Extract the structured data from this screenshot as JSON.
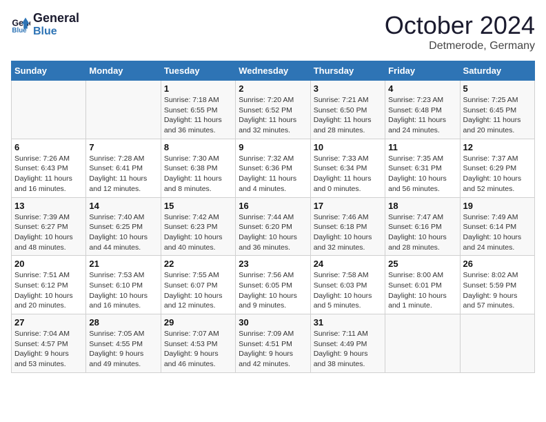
{
  "header": {
    "logo_line1": "General",
    "logo_line2": "Blue",
    "month_title": "October 2024",
    "location": "Detmerode, Germany"
  },
  "weekdays": [
    "Sunday",
    "Monday",
    "Tuesday",
    "Wednesday",
    "Thursday",
    "Friday",
    "Saturday"
  ],
  "weeks": [
    [
      {
        "day": "",
        "info": ""
      },
      {
        "day": "",
        "info": ""
      },
      {
        "day": "1",
        "info": "Sunrise: 7:18 AM\nSunset: 6:55 PM\nDaylight: 11 hours\nand 36 minutes."
      },
      {
        "day": "2",
        "info": "Sunrise: 7:20 AM\nSunset: 6:52 PM\nDaylight: 11 hours\nand 32 minutes."
      },
      {
        "day": "3",
        "info": "Sunrise: 7:21 AM\nSunset: 6:50 PM\nDaylight: 11 hours\nand 28 minutes."
      },
      {
        "day": "4",
        "info": "Sunrise: 7:23 AM\nSunset: 6:48 PM\nDaylight: 11 hours\nand 24 minutes."
      },
      {
        "day": "5",
        "info": "Sunrise: 7:25 AM\nSunset: 6:45 PM\nDaylight: 11 hours\nand 20 minutes."
      }
    ],
    [
      {
        "day": "6",
        "info": "Sunrise: 7:26 AM\nSunset: 6:43 PM\nDaylight: 11 hours\nand 16 minutes."
      },
      {
        "day": "7",
        "info": "Sunrise: 7:28 AM\nSunset: 6:41 PM\nDaylight: 11 hours\nand 12 minutes."
      },
      {
        "day": "8",
        "info": "Sunrise: 7:30 AM\nSunset: 6:38 PM\nDaylight: 11 hours\nand 8 minutes."
      },
      {
        "day": "9",
        "info": "Sunrise: 7:32 AM\nSunset: 6:36 PM\nDaylight: 11 hours\nand 4 minutes."
      },
      {
        "day": "10",
        "info": "Sunrise: 7:33 AM\nSunset: 6:34 PM\nDaylight: 11 hours\nand 0 minutes."
      },
      {
        "day": "11",
        "info": "Sunrise: 7:35 AM\nSunset: 6:31 PM\nDaylight: 10 hours\nand 56 minutes."
      },
      {
        "day": "12",
        "info": "Sunrise: 7:37 AM\nSunset: 6:29 PM\nDaylight: 10 hours\nand 52 minutes."
      }
    ],
    [
      {
        "day": "13",
        "info": "Sunrise: 7:39 AM\nSunset: 6:27 PM\nDaylight: 10 hours\nand 48 minutes."
      },
      {
        "day": "14",
        "info": "Sunrise: 7:40 AM\nSunset: 6:25 PM\nDaylight: 10 hours\nand 44 minutes."
      },
      {
        "day": "15",
        "info": "Sunrise: 7:42 AM\nSunset: 6:23 PM\nDaylight: 10 hours\nand 40 minutes."
      },
      {
        "day": "16",
        "info": "Sunrise: 7:44 AM\nSunset: 6:20 PM\nDaylight: 10 hours\nand 36 minutes."
      },
      {
        "day": "17",
        "info": "Sunrise: 7:46 AM\nSunset: 6:18 PM\nDaylight: 10 hours\nand 32 minutes."
      },
      {
        "day": "18",
        "info": "Sunrise: 7:47 AM\nSunset: 6:16 PM\nDaylight: 10 hours\nand 28 minutes."
      },
      {
        "day": "19",
        "info": "Sunrise: 7:49 AM\nSunset: 6:14 PM\nDaylight: 10 hours\nand 24 minutes."
      }
    ],
    [
      {
        "day": "20",
        "info": "Sunrise: 7:51 AM\nSunset: 6:12 PM\nDaylight: 10 hours\nand 20 minutes."
      },
      {
        "day": "21",
        "info": "Sunrise: 7:53 AM\nSunset: 6:10 PM\nDaylight: 10 hours\nand 16 minutes."
      },
      {
        "day": "22",
        "info": "Sunrise: 7:55 AM\nSunset: 6:07 PM\nDaylight: 10 hours\nand 12 minutes."
      },
      {
        "day": "23",
        "info": "Sunrise: 7:56 AM\nSunset: 6:05 PM\nDaylight: 10 hours\nand 9 minutes."
      },
      {
        "day": "24",
        "info": "Sunrise: 7:58 AM\nSunset: 6:03 PM\nDaylight: 10 hours\nand 5 minutes."
      },
      {
        "day": "25",
        "info": "Sunrise: 8:00 AM\nSunset: 6:01 PM\nDaylight: 10 hours\nand 1 minute."
      },
      {
        "day": "26",
        "info": "Sunrise: 8:02 AM\nSunset: 5:59 PM\nDaylight: 9 hours\nand 57 minutes."
      }
    ],
    [
      {
        "day": "27",
        "info": "Sunrise: 7:04 AM\nSunset: 4:57 PM\nDaylight: 9 hours\nand 53 minutes."
      },
      {
        "day": "28",
        "info": "Sunrise: 7:05 AM\nSunset: 4:55 PM\nDaylight: 9 hours\nand 49 minutes."
      },
      {
        "day": "29",
        "info": "Sunrise: 7:07 AM\nSunset: 4:53 PM\nDaylight: 9 hours\nand 46 minutes."
      },
      {
        "day": "30",
        "info": "Sunrise: 7:09 AM\nSunset: 4:51 PM\nDaylight: 9 hours\nand 42 minutes."
      },
      {
        "day": "31",
        "info": "Sunrise: 7:11 AM\nSunset: 4:49 PM\nDaylight: 9 hours\nand 38 minutes."
      },
      {
        "day": "",
        "info": ""
      },
      {
        "day": "",
        "info": ""
      }
    ]
  ]
}
